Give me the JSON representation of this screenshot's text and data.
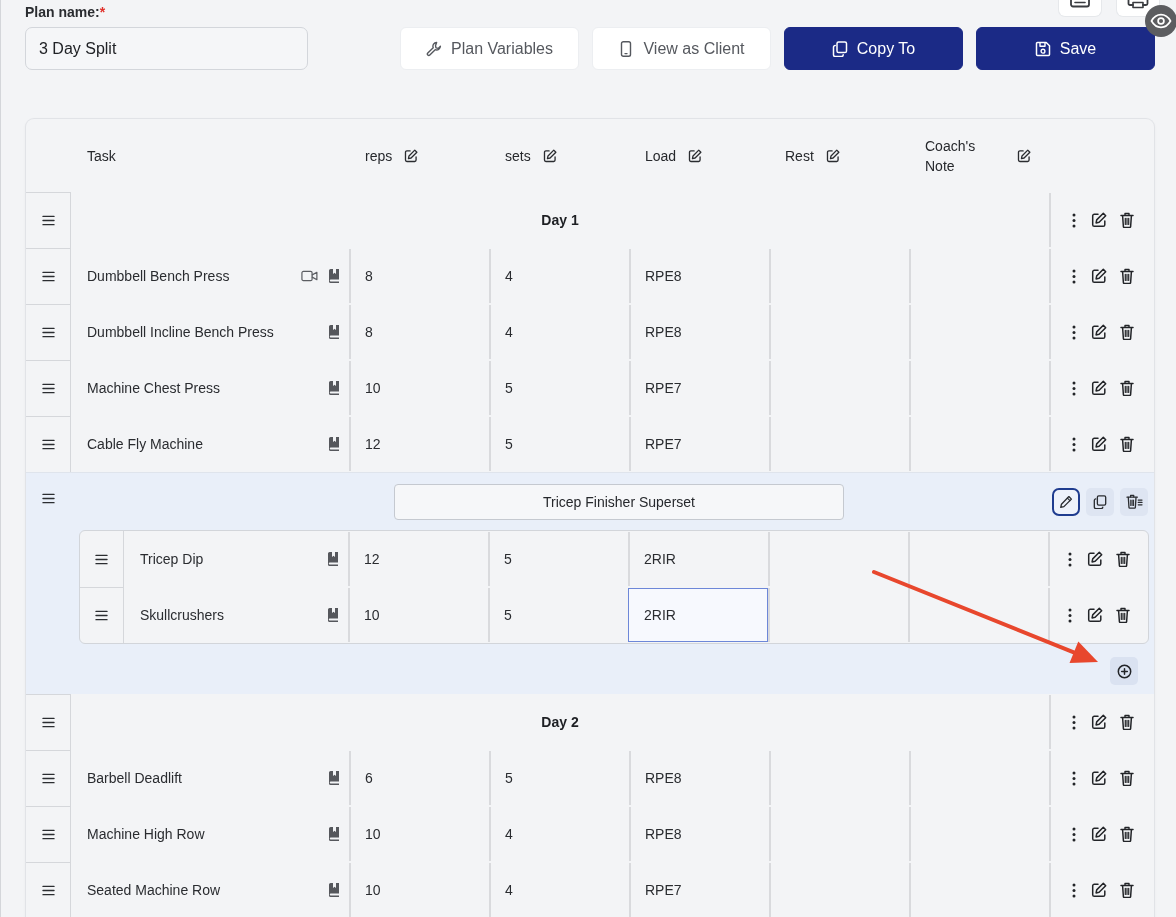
{
  "plan_name": {
    "label": "Plan name:",
    "required_mark": "*",
    "value": "3 Day Split"
  },
  "actions": [
    {
      "label": "Plan Variables",
      "primary": false
    },
    {
      "label": "View as Client",
      "primary": false
    },
    {
      "label": "Copy To",
      "primary": true
    },
    {
      "label": "Save",
      "primary": true
    }
  ],
  "table": {
    "columns": [
      {
        "label": "Task",
        "editable": false
      },
      {
        "label": "reps",
        "editable": true
      },
      {
        "label": "sets",
        "editable": true
      },
      {
        "label": "Load",
        "editable": true
      },
      {
        "label": "Rest",
        "editable": true
      },
      {
        "label": "Coach's Note",
        "editable": true
      }
    ],
    "rows": [
      {
        "kind": "day",
        "title": "Day 1"
      },
      {
        "kind": "exercise",
        "task": "Dumbbell Bench Press",
        "video": true,
        "cells": [
          {
            "value": "8",
            "focused": false
          },
          {
            "value": "4",
            "focused": false
          },
          {
            "value": "RPE8",
            "focused": false
          }
        ]
      },
      {
        "kind": "exercise",
        "task": "Dumbbell Incline Bench Press",
        "video": false,
        "cells": [
          {
            "value": "8",
            "focused": false
          },
          {
            "value": "4",
            "focused": false
          },
          {
            "value": "RPE8",
            "focused": false
          }
        ]
      },
      {
        "kind": "exercise",
        "task": "Machine Chest Press",
        "video": false,
        "cells": [
          {
            "value": "10",
            "focused": false
          },
          {
            "value": "5",
            "focused": false
          },
          {
            "value": "RPE7",
            "focused": false
          }
        ]
      },
      {
        "kind": "exercise",
        "task": "Cable Fly Machine",
        "video": false,
        "cells": [
          {
            "value": "12",
            "focused": false
          },
          {
            "value": "5",
            "focused": false
          },
          {
            "value": "RPE7",
            "focused": false
          }
        ]
      },
      {
        "kind": "superset",
        "title": "Tricep Finisher Superset",
        "editing": true,
        "children": [
          {
            "kind": "exercise",
            "task": "Tricep Dip",
            "video": false,
            "cells": [
              {
                "value": "12",
                "focused": false
              },
              {
                "value": "5",
                "focused": false
              },
              {
                "value": "2RIR",
                "focused": false
              }
            ]
          },
          {
            "kind": "exercise",
            "task": "Skullcrushers",
            "video": false,
            "cells": [
              {
                "value": "10",
                "focused": false
              },
              {
                "value": "5",
                "focused": false
              },
              {
                "value": "2RIR",
                "focused": true
              }
            ]
          }
        ]
      },
      {
        "kind": "day",
        "title": "Day 2"
      },
      {
        "kind": "exercise",
        "task": "Barbell Deadlift",
        "video": false,
        "cells": [
          {
            "value": "6",
            "focused": false
          },
          {
            "value": "5",
            "focused": false
          },
          {
            "value": "RPE8",
            "focused": false
          }
        ]
      },
      {
        "kind": "exercise",
        "task": "Machine High Row",
        "video": false,
        "cells": [
          {
            "value": "10",
            "focused": false
          },
          {
            "value": "4",
            "focused": false
          },
          {
            "value": "RPE8",
            "focused": false
          }
        ]
      },
      {
        "kind": "exercise",
        "task": "Seated Machine Row",
        "video": false,
        "cells": [
          {
            "value": "10",
            "focused": false
          },
          {
            "value": "4",
            "focused": false
          },
          {
            "value": "RPE7",
            "focused": false
          }
        ]
      }
    ]
  }
}
